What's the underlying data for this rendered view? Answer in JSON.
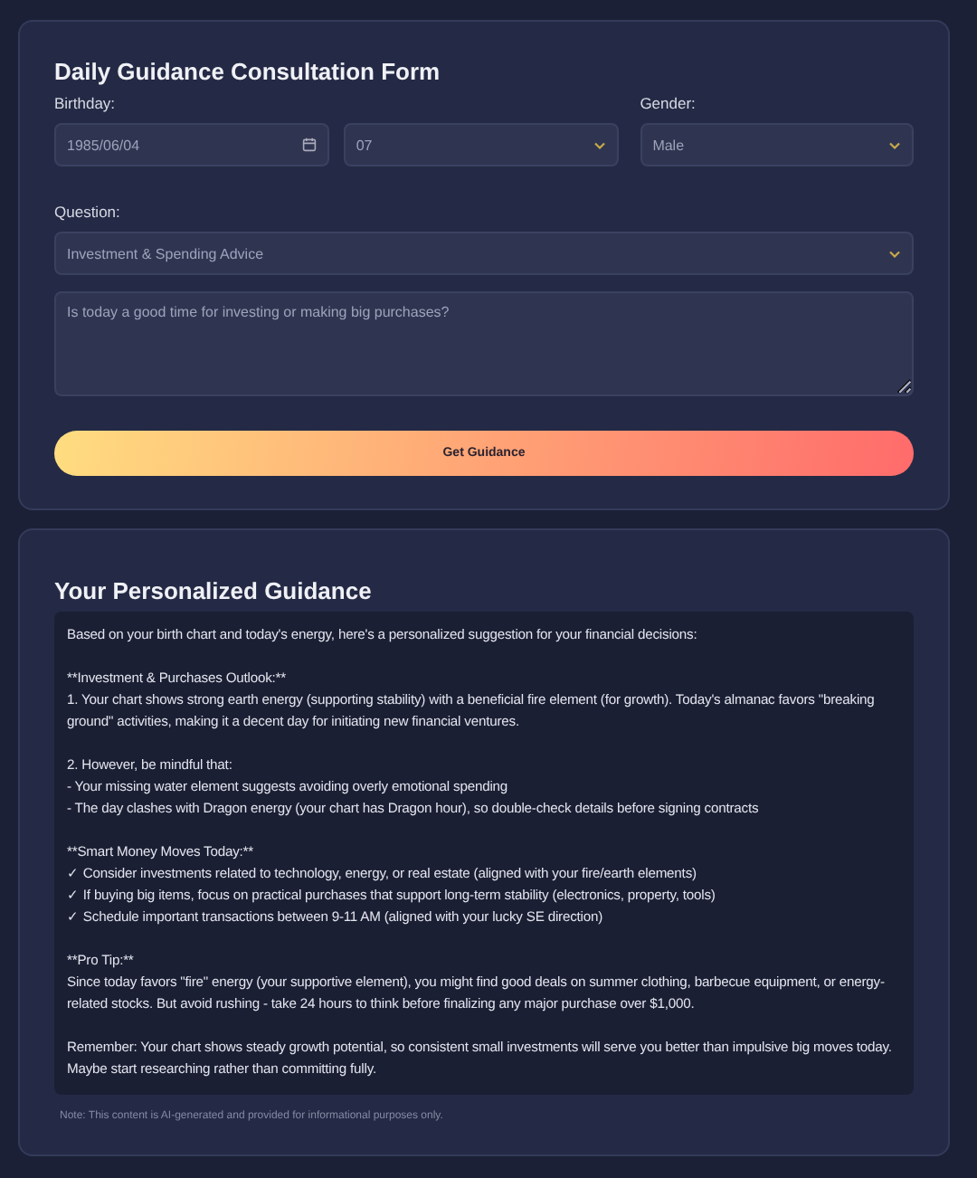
{
  "form": {
    "title": "Daily Guidance Consultation Form",
    "birthday": {
      "label": "Birthday:",
      "date": "1985/06/04",
      "hour": "07"
    },
    "gender": {
      "label": "Gender:",
      "value": "Male"
    },
    "question": {
      "label": "Question:",
      "topic": "Investment & Spending Advice",
      "placeholder": "Is today a good time for investing or making big purchases?"
    },
    "submit": "Get Guidance"
  },
  "result": {
    "title": "Your Personalized Guidance",
    "paragraphs": [
      [
        "Based on your birth chart and today's energy, here's a personalized suggestion for your financial decisions:"
      ],
      [
        "**Investment & Purchases Outlook:**",
        "1. Your chart shows strong earth energy (supporting stability) with a beneficial fire element (for growth). Today's almanac favors \"breaking ground\" activities, making it a decent day for initiating new financial ventures."
      ],
      [
        "2. However, be mindful that:",
        "- Your missing water element suggests avoiding overly emotional spending",
        "- The day clashes with Dragon energy (your chart has Dragon hour), so double-check details before signing contracts"
      ],
      [
        "**Smart Money Moves Today:**",
        "✓ Consider investments related to technology, energy, or real estate (aligned with your fire/earth elements)",
        "✓ If buying big items, focus on practical purchases that support long-term stability (electronics, property, tools)",
        "✓ Schedule important transactions between 9-11 AM (aligned with your lucky SE direction)"
      ],
      [
        "**Pro Tip:**",
        "Since today favors \"fire\" energy (your supportive element), you might find good deals on summer clothing, barbecue equipment, or energy-related stocks. But avoid rushing - take 24 hours to think before finalizing any major purchase over $1,000."
      ],
      [
        "Remember: Your chart shows steady growth potential, so consistent small investments will serve you better than impulsive big moves today. Maybe start researching rather than committing fully."
      ]
    ],
    "note": "Note:  This content is AI-generated and provided for informational purposes only."
  }
}
